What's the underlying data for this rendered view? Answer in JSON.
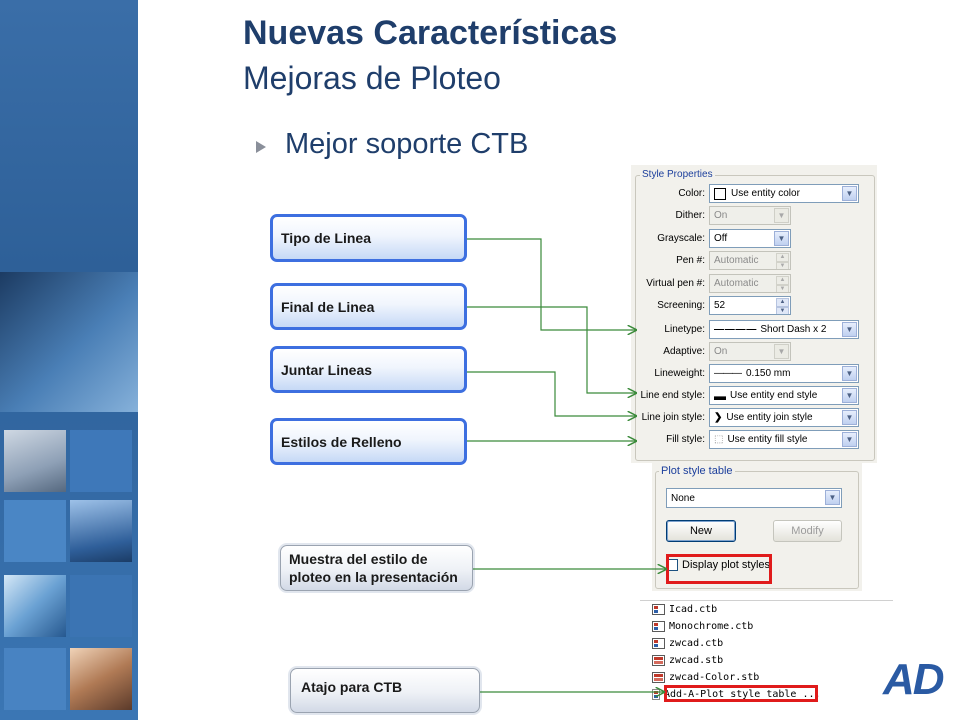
{
  "title": {
    "main": "Nuevas Características",
    "sub": "Mejoras de Ploteo"
  },
  "bullet": "Mejor soporte CTB",
  "callouts": {
    "linetype": "Tipo de Linea",
    "line_end": "Final de Linea",
    "line_join": "Juntar Lineas",
    "fill": "Estilos de Relleno",
    "display": "Muestra del estilo de ploteo en la presentación",
    "shortcut": "Atajo para CTB"
  },
  "style_properties": {
    "legend": "Style Properties",
    "color_label": "Color:",
    "color_value": "Use entity color",
    "dither_label": "Dither:",
    "dither_value": "On",
    "grayscale_label": "Grayscale:",
    "grayscale_value": "Off",
    "pen_label": "Pen #:",
    "pen_value": "Automatic",
    "vpen_label": "Virtual pen #:",
    "vpen_value": "Automatic",
    "screening_label": "Screening:",
    "screening_value": "52",
    "linetype_label": "Linetype:",
    "linetype_value": "Short Dash x 2",
    "adaptive_label": "Adaptive:",
    "adaptive_value": "On",
    "lineweight_label": "Lineweight:",
    "lineweight_value": "0.150 mm",
    "lineend_label": "Line end style:",
    "lineend_value": "Use entity end style",
    "linejoin_label": "Line join style:",
    "linejoin_value": "Use entity join style",
    "fill_label": "Fill style:",
    "fill_value": "Use entity fill style"
  },
  "plot_style_table": {
    "legend": "Plot style table",
    "selected": "None",
    "new_button": "New",
    "modify_button": "Modify",
    "display_checkbox": "Display plot styles"
  },
  "files": [
    "Icad.ctb",
    "Monochrome.ctb",
    "zwcad.ctb",
    "zwcad.stb",
    "zwcad-Color.stb",
    "Add-A-Plot style table ..."
  ],
  "logo_text": "AD",
  "colors": {
    "title": "#1f3e6b",
    "callout_border": "#3d6fe0",
    "connector": "#3a8a3a",
    "highlight": "#e01b1b"
  }
}
